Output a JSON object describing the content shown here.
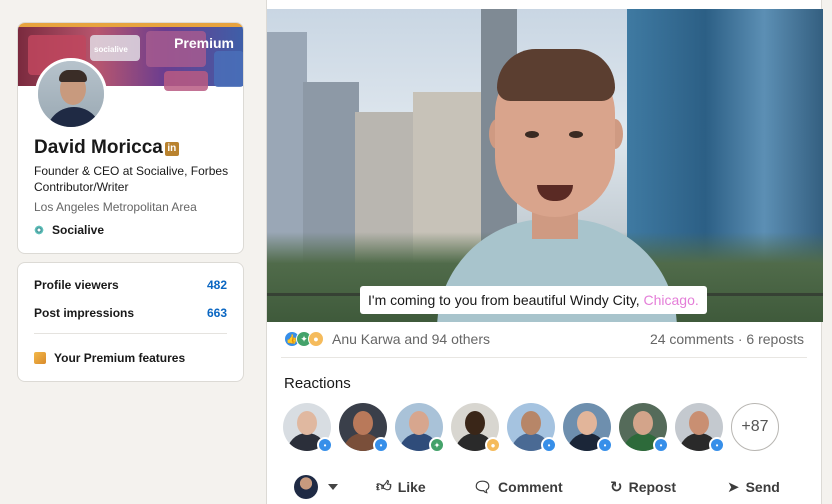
{
  "profile": {
    "banner_brand": "socialive",
    "premium_label": "Premium",
    "name": "David Moricca",
    "linkedin_badge": "in",
    "headline": "Founder & CEO at Socialive, Forbes Contributor/Writer",
    "location": "Los Angeles Metropolitan Area",
    "company": "Socialive"
  },
  "stats": {
    "profile_viewers_label": "Profile viewers",
    "profile_viewers_value": "482",
    "post_impressions_label": "Post impressions",
    "post_impressions_value": "663",
    "premium_features_label": "Your Premium features"
  },
  "post": {
    "caption_text": "I'm coming to you from beautiful Windy City, ",
    "caption_highlight": "Chicago.",
    "reactions_summary": "Anu Karwa and 94 others",
    "engagement_summary": "24 comments · 6 reposts",
    "reactions_title": "Reactions",
    "more_reactors": "+87",
    "actions": {
      "like": "Like",
      "comment": "Comment",
      "repost": "Repost",
      "send": "Send"
    }
  },
  "reactors": [
    {
      "skin": "#e0b8a0",
      "shirt": "#2b2f3a",
      "bg": "#d8dde2",
      "reaction": "like"
    },
    {
      "skin": "#b9795a",
      "shirt": "#7a4f3a",
      "bg": "#3a3f4a",
      "reaction": "like"
    },
    {
      "skin": "#d7a68e",
      "shirt": "#2f4c7a",
      "bg": "#a9c2d8",
      "reaction": "celebrate"
    },
    {
      "skin": "#3a2618",
      "shirt": "#2a2a2a",
      "bg": "#d8d6d0",
      "reaction": "insightful"
    },
    {
      "skin": "#b78668",
      "shirt": "#4a6a94",
      "bg": "#a5c3e0",
      "reaction": "like"
    },
    {
      "skin": "#e2b59a",
      "shirt": "#1b2638",
      "bg": "#6e8fae",
      "reaction": "like"
    },
    {
      "skin": "#d3a48a",
      "shirt": "#2d6a3a",
      "bg": "#556b5a",
      "reaction": "like"
    },
    {
      "skin": "#c98f72",
      "shirt": "#2a2a2a",
      "bg": "#c4c9cf",
      "reaction": "like"
    }
  ],
  "colors": {
    "accent_blue": "#0a66c2",
    "premium_gold": "#b9822e",
    "caption_highlight": "#e47ed8",
    "like": "#378fe9",
    "celebrate": "#44a26a",
    "insightful": "#f5bb5c"
  },
  "icons": {
    "like": "thumbs-up-icon",
    "comment": "comment-icon",
    "repost": "repost-icon",
    "send": "send-icon"
  }
}
